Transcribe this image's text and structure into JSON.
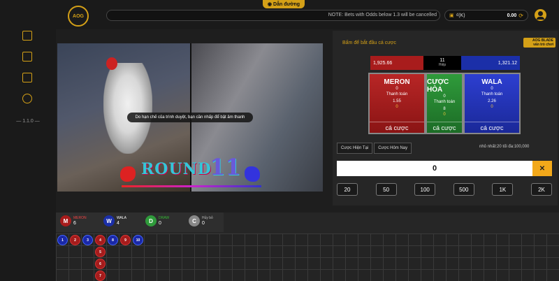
{
  "header": {
    "logo_text": "AOG",
    "guide_label": "Dẫn đường",
    "notice": "NOTE: Bets with Odds below 1.3 will be cancelled",
    "currency_label": "₫(K)",
    "balance": "0.00"
  },
  "sidebar": {
    "version": "1.1.0"
  },
  "video": {
    "tip": "Do hạn chế của trình duyệt, bạn cần nhấp để bật âm thanh",
    "round_label": "ROUND",
    "round_number": "11"
  },
  "panel": {
    "title": "Bấm để bắt đầu cá cược",
    "brand_line1": "AOG BLADE",
    "brand_line2": "vấn trò chơi",
    "pool_meron": "1,925.66",
    "pool_round": "11",
    "pool_round_sub": "Hiệp",
    "pool_wala": "1,321.12",
    "meron": {
      "name": "MERON",
      "value": "0",
      "payout_label": "Thanh toán",
      "odds": "1.55",
      "amount": "0",
      "cta": "cá cược"
    },
    "draw": {
      "name": "CƯỢC HÒA",
      "value": "0",
      "payout_label": "Thanh toán",
      "odds": "8",
      "amount": "0",
      "cta": "cá cược"
    },
    "wala": {
      "name": "WALA",
      "value": "0",
      "payout_label": "Thanh toán",
      "odds": "2.26",
      "amount": "0",
      "cta": "cá cược"
    },
    "tab_current": "Cược Hiện Tại",
    "tab_today": "Cược Hôm Nay",
    "limits": "nhỏ nhất:20   tối đa:100,000",
    "amount_value": "0",
    "clear_label": "✕",
    "chips": [
      "20",
      "50",
      "100",
      "500",
      "1K",
      "2K"
    ]
  },
  "results": {
    "meron": {
      "letter": "M",
      "label": "MERON",
      "count": "6"
    },
    "wala": {
      "letter": "W",
      "label": "WALA",
      "count": "4"
    },
    "draw": {
      "letter": "D",
      "label": "DRAW",
      "count": "0"
    },
    "cancel": {
      "letter": "C",
      "label": "Hủy bỏ",
      "count": "0"
    },
    "beads": [
      {
        "n": "1",
        "side": "b"
      },
      {
        "n": "2",
        "side": "r"
      },
      {
        "n": "3",
        "side": "b"
      },
      {
        "n": "4",
        "side": "r"
      },
      {
        "n": "5",
        "side": "r"
      },
      {
        "n": "6",
        "side": "r"
      },
      {
        "n": "7",
        "side": "r"
      },
      {
        "n": "8",
        "side": "b"
      },
      {
        "n": "9",
        "side": "r"
      },
      {
        "n": "10",
        "side": "b"
      }
    ]
  },
  "colors": {
    "accent": "#d4a017",
    "meron": "#a81c1c",
    "wala": "#1b2fa8",
    "draw": "#2f9b3b"
  }
}
